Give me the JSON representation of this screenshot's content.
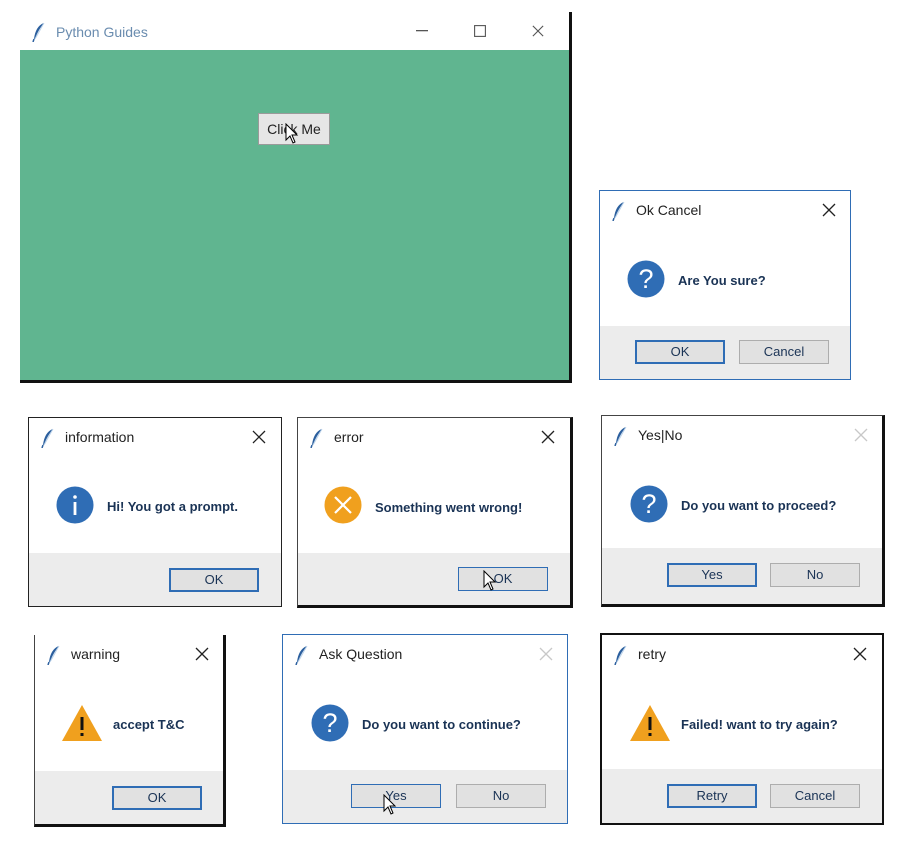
{
  "main_window": {
    "title": "Python Guides",
    "button_label": "Click Me",
    "bg_color": "#60b590"
  },
  "dialogs": {
    "ok_cancel": {
      "title": "Ok Cancel",
      "icon": "question-icon",
      "message": "Are You sure?",
      "buttons": [
        "OK",
        "Cancel"
      ]
    },
    "information": {
      "title": "information",
      "icon": "info-icon",
      "message": "Hi! You got a prompt.",
      "buttons": [
        "OK"
      ]
    },
    "error": {
      "title": "error",
      "icon": "error-icon",
      "message": "Something went wrong!",
      "buttons": [
        "OK"
      ]
    },
    "yes_no": {
      "title": "Yes|No",
      "icon": "question-icon",
      "message": "Do you want to proceed?",
      "buttons": [
        "Yes",
        "No"
      ]
    },
    "warning": {
      "title": "warning",
      "icon": "warning-icon",
      "message": "accept T&C",
      "buttons": [
        "OK"
      ]
    },
    "ask_question": {
      "title": "Ask Question",
      "icon": "question-icon",
      "message": "Do you want to continue?",
      "buttons": [
        "Yes",
        "No"
      ]
    },
    "retry": {
      "title": "retry",
      "icon": "warning-icon",
      "message": "Failed! want to try again?",
      "buttons": [
        "Retry",
        "Cancel"
      ]
    }
  },
  "colors": {
    "accent_blue": "#2f6db5",
    "warning_orange": "#f0a01e",
    "error_orange": "#f0a01e",
    "text_dark": "#1a3355"
  }
}
